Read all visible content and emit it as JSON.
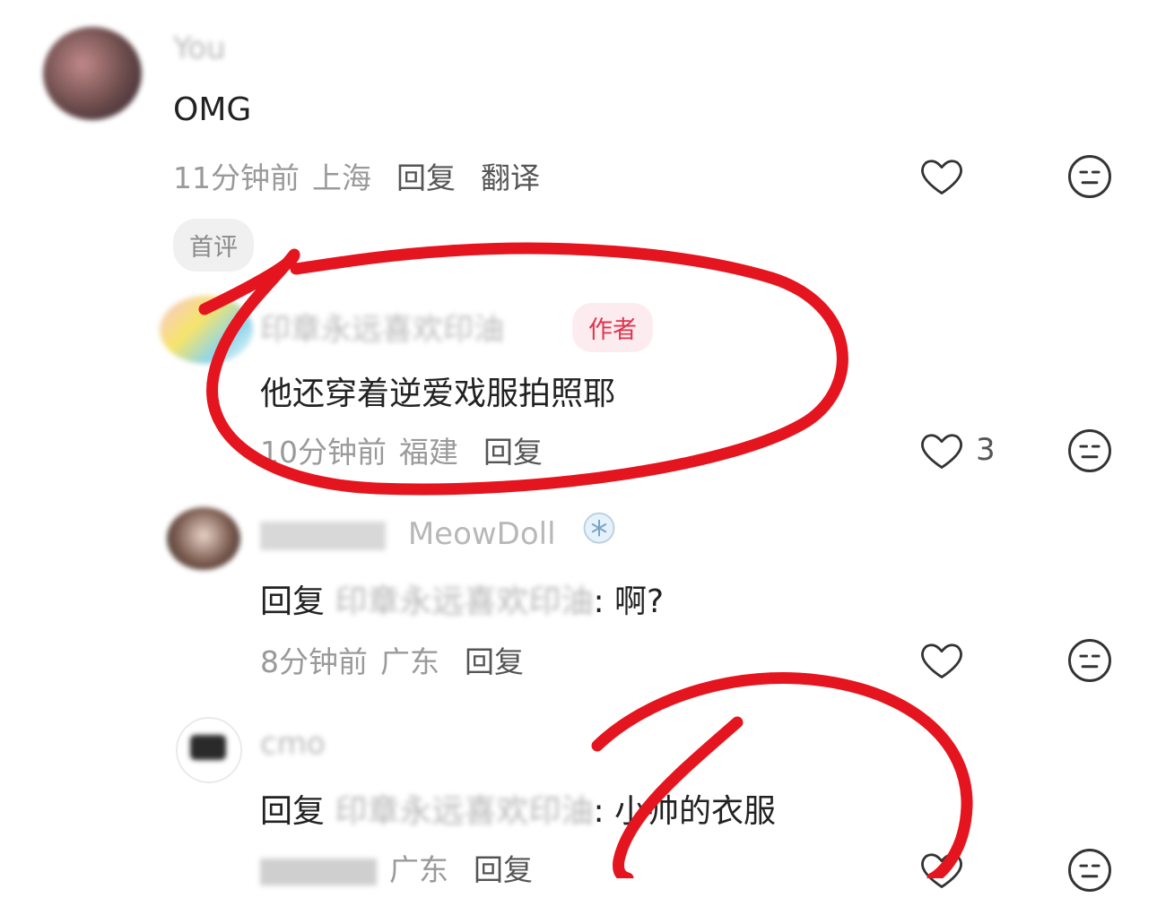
{
  "comments": [
    {
      "username": "You",
      "content": "OMG",
      "time": "11分钟前",
      "region": "上海",
      "reply_label": "回复",
      "translate_label": "翻译",
      "tag": "首评"
    },
    {
      "username": "印章永远喜欢印油",
      "author_badge": "作者",
      "content": "他还穿着逆爱戏服拍照耶",
      "time": "10分钟前",
      "region": "福建",
      "reply_label": "回复",
      "like_count": "3"
    },
    {
      "username": "MeowDoll",
      "reply_prefix": "回复",
      "reply_target": "印章永远喜欢印油",
      "reply_text": ": 啊?",
      "time": "8分钟前",
      "region": "广东",
      "reply_label": "回复"
    },
    {
      "username": "cmo",
      "reply_prefix": "回复",
      "reply_target": "印章永远喜欢印油",
      "reply_text": ": 小帅的衣服",
      "time": "",
      "region": "广东",
      "reply_label": "回复"
    }
  ],
  "colors": {
    "annotation": "#e5151f",
    "author_badge_bg": "#fdecef",
    "author_badge_text": "#e0344d",
    "icon_stroke": "#333333"
  },
  "icons": [
    "heart-icon",
    "meh-face-icon"
  ]
}
